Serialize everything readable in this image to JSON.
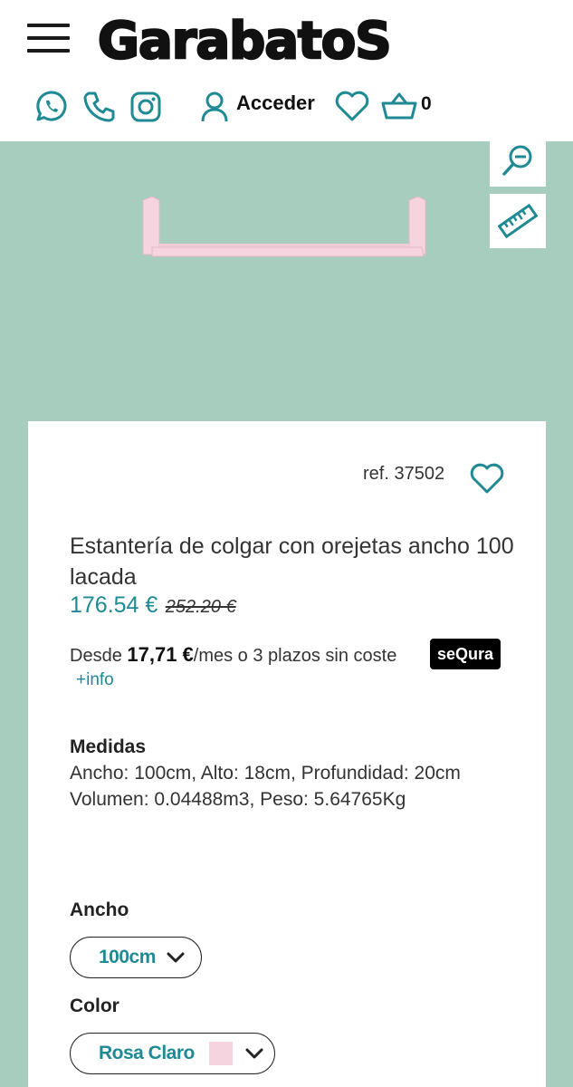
{
  "header": {
    "brand": "GarabatoS",
    "login_label": "Acceder",
    "cart_count": "0",
    "icons": [
      "menu-icon",
      "whatsapp-icon",
      "phone-icon",
      "instagram-icon",
      "user-icon",
      "heart-icon",
      "basket-icon"
    ]
  },
  "gallery": {
    "background_color": "#a6cdbd",
    "product_color": "#f6d4df",
    "tools": [
      "zoom-out-icon",
      "ruler-icon"
    ]
  },
  "product": {
    "ref": "ref. 37502",
    "title": "Estantería de colgar con orejetas ancho 100 lacada",
    "price": "176.54 €",
    "old_price": "252.20 €",
    "finance_prefix": "Desde",
    "finance_amount": "17,71 €",
    "finance_suffix": "/mes o 3 plazos sin coste",
    "finance_brand": "seQura",
    "info_link": "+info",
    "measures_heading": "Medidas",
    "measures_line1": "Ancho: 100cm, Alto: 18cm, Profundidad: 20cm",
    "measures_line2": "Volumen: 0.04488m3, Peso: 5.64765Kg",
    "width_label": "Ancho",
    "width_value": "100cm",
    "color_label": "Color",
    "color_value": "Rosa Claro",
    "color_swatch": "#f6d4df"
  },
  "colors": {
    "accent": "#1f8a93",
    "background": "#a6cdbd"
  }
}
